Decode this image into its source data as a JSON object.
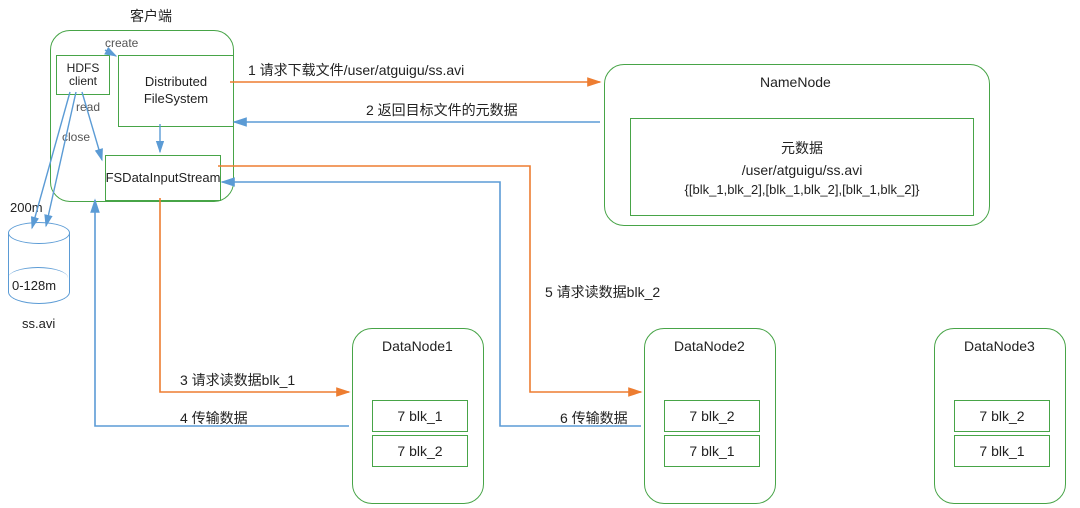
{
  "title": "客户端",
  "client": {
    "hdfs": "HDFS client",
    "dfs": "Distributed FileSystem",
    "fsis": "FSDataInputStream",
    "create": "create",
    "read": "read",
    "close": "close"
  },
  "cylinder": {
    "size": "200m",
    "range": "0-128m",
    "file": "ss.avi"
  },
  "namenode": {
    "title": "NameNode",
    "meta_title": "元数据",
    "path": "/user/atguigu/ss.avi",
    "blocks": "{[blk_1,blk_2],[blk_1,blk_2],[blk_1,blk_2]}"
  },
  "datanodes": {
    "dn1": {
      "title": "DataNode1",
      "b1": "7 blk_1",
      "b2": "7 blk_2"
    },
    "dn2": {
      "title": "DataNode2",
      "b1": "7 blk_2",
      "b2": "7 blk_1"
    },
    "dn3": {
      "title": "DataNode3",
      "b1": "7 blk_2",
      "b2": "7 blk_1"
    }
  },
  "steps": {
    "s1": "1 请求下载文件/user/atguigu/ss.avi",
    "s2": "2 返回目标文件的元数据",
    "s3": "3 请求读数据blk_1",
    "s4": "4 传输数据",
    "s5": "5 请求读数据blk_2",
    "s6": "6 传输数据"
  }
}
